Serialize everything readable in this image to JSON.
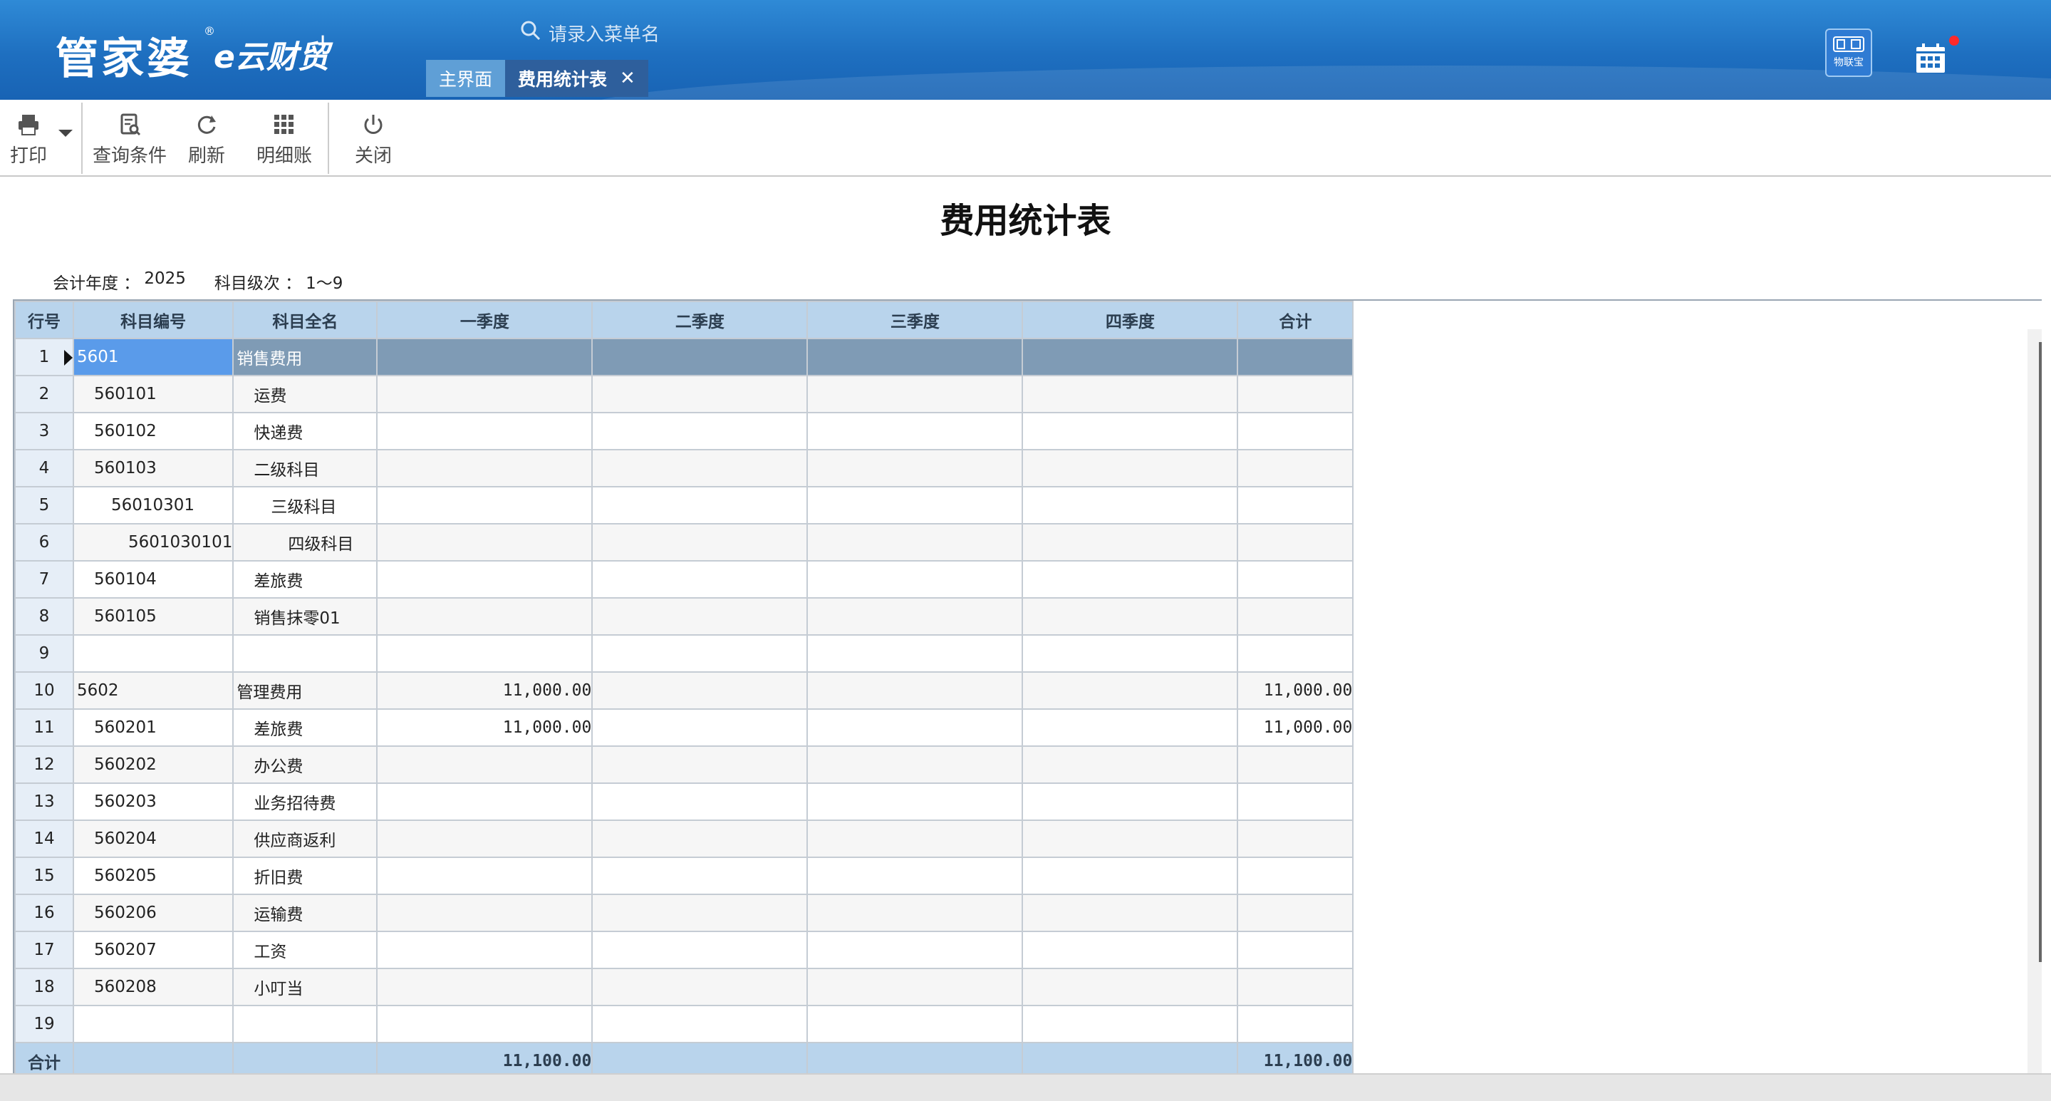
{
  "header": {
    "logo_main": "管家婆",
    "logo_reg": "®",
    "logo_sub": "e云财贸",
    "logo_plus": "+",
    "search_placeholder": "请录入菜单名",
    "tabs": [
      {
        "label": "主界面"
      },
      {
        "label": "费用统计表",
        "close": "✕"
      }
    ],
    "iot_label": "物联宝",
    "notification_color": "#ff2a2a"
  },
  "toolbar": {
    "print": "打印",
    "query": "查询条件",
    "refresh": "刷新",
    "detail": "明细账",
    "close": "关闭"
  },
  "report": {
    "title": "费用统计表",
    "fiscal_year_label": "会计年度 ：",
    "fiscal_year": "2025",
    "level_label": "科目级次 ：",
    "level": "1～9"
  },
  "table": {
    "headers": [
      "行号",
      "科目编号",
      "科目全名",
      "一季度",
      "二季度",
      "三季度",
      "四季度",
      "合计"
    ],
    "rows": [
      {
        "no": "1",
        "code": "5601",
        "name": "销售费用",
        "q1": "",
        "q2": "",
        "q3": "",
        "q4": "",
        "total": ""
      },
      {
        "no": "2",
        "code": "560101",
        "name": "运费",
        "q1": "",
        "q2": "",
        "q3": "",
        "q4": "",
        "total": ""
      },
      {
        "no": "3",
        "code": "560102",
        "name": "快递费",
        "q1": "",
        "q2": "",
        "q3": "",
        "q4": "",
        "total": ""
      },
      {
        "no": "4",
        "code": "560103",
        "name": "二级科目",
        "q1": "",
        "q2": "",
        "q3": "",
        "q4": "",
        "total": ""
      },
      {
        "no": "5",
        "code": "56010301",
        "name": "三级科目",
        "q1": "",
        "q2": "",
        "q3": "",
        "q4": "",
        "total": ""
      },
      {
        "no": "6",
        "code": "5601030101",
        "name": "四级科目",
        "q1": "",
        "q2": "",
        "q3": "",
        "q4": "",
        "total": ""
      },
      {
        "no": "7",
        "code": "560104",
        "name": "差旅费",
        "q1": "",
        "q2": "",
        "q3": "",
        "q4": "",
        "total": ""
      },
      {
        "no": "8",
        "code": "560105",
        "name": "销售抹零01",
        "q1": "",
        "q2": "",
        "q3": "",
        "q4": "",
        "total": ""
      },
      {
        "no": "9",
        "code": "",
        "name": "",
        "q1": "",
        "q2": "",
        "q3": "",
        "q4": "",
        "total": ""
      },
      {
        "no": "10",
        "code": "5602",
        "name": "管理费用",
        "q1": "11,000.00",
        "q2": "",
        "q3": "",
        "q4": "",
        "total": "11,000.00"
      },
      {
        "no": "11",
        "code": "560201",
        "name": "差旅费",
        "q1": "11,000.00",
        "q2": "",
        "q3": "",
        "q4": "",
        "total": "11,000.00"
      },
      {
        "no": "12",
        "code": "560202",
        "name": "办公费",
        "q1": "",
        "q2": "",
        "q3": "",
        "q4": "",
        "total": ""
      },
      {
        "no": "13",
        "code": "560203",
        "name": "业务招待费",
        "q1": "",
        "q2": "",
        "q3": "",
        "q4": "",
        "total": ""
      },
      {
        "no": "14",
        "code": "560204",
        "name": "供应商返利",
        "q1": "",
        "q2": "",
        "q3": "",
        "q4": "",
        "total": ""
      },
      {
        "no": "15",
        "code": "560205",
        "name": "折旧费",
        "q1": "",
        "q2": "",
        "q3": "",
        "q4": "",
        "total": ""
      },
      {
        "no": "16",
        "code": "560206",
        "name": "运输费",
        "q1": "",
        "q2": "",
        "q3": "",
        "q4": "",
        "total": ""
      },
      {
        "no": "17",
        "code": "560207",
        "name": "工资",
        "q1": "",
        "q2": "",
        "q3": "",
        "q4": "",
        "total": ""
      },
      {
        "no": "18",
        "code": "560208",
        "name": "小叮当",
        "q1": "",
        "q2": "",
        "q3": "",
        "q4": "",
        "total": ""
      },
      {
        "no": "19",
        "code": "",
        "name": "",
        "q1": "",
        "q2": "",
        "q3": "",
        "q4": "",
        "total": ""
      }
    ],
    "footer": {
      "label": "合计",
      "q1": "11,100.00",
      "q2": "",
      "q3": "",
      "q4": "",
      "total": "11,100.00"
    }
  }
}
